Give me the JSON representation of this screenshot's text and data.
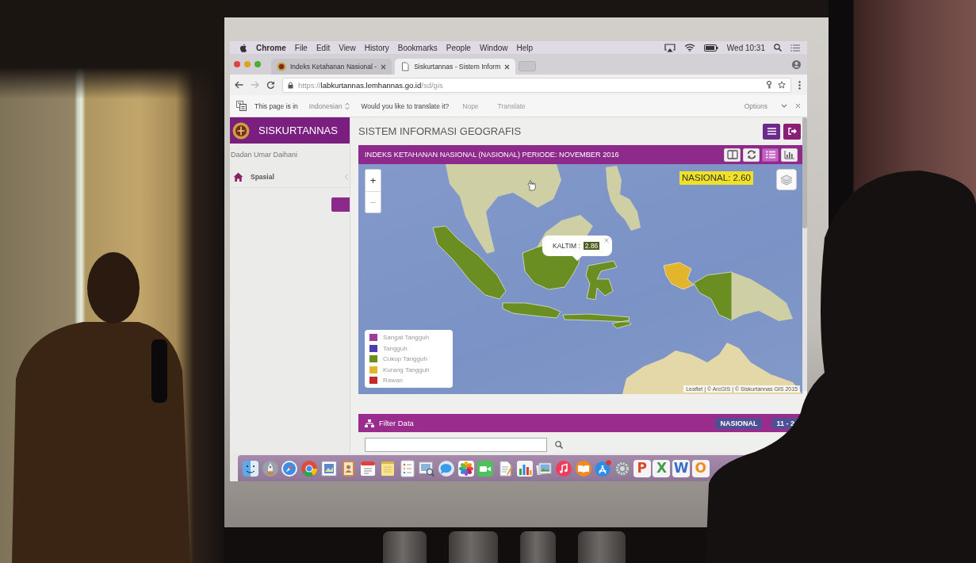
{
  "menu_bar": {
    "app": "Chrome",
    "menus": [
      "File",
      "Edit",
      "View",
      "History",
      "Bookmarks",
      "People",
      "Window",
      "Help"
    ],
    "clock": "Wed 10:31"
  },
  "tabs": [
    {
      "title": "Indeks Ketahanan Nasional -",
      "kind": "emblem",
      "selected": false
    },
    {
      "title": "Siskurtannas - Sistem Inform",
      "kind": "page",
      "selected": true
    }
  ],
  "address_bar": {
    "scheme": "https://",
    "host": "labkurtannas.lemhannas.go.id",
    "path": "/sd/gis"
  },
  "translate_bar": {
    "prompt": "This page is in",
    "language": "Indonesian",
    "question": "Would you like to translate it?",
    "actions": [
      "Nope",
      "Translate"
    ],
    "options": "Options"
  },
  "sidebar": {
    "brand": "SISKURTANNAS",
    "user": "Dadan Umar Daihani",
    "items": [
      {
        "label": "Spasial"
      }
    ]
  },
  "page_title": "SISTEM INFORMASI GEOGRAFIS",
  "map_panel": {
    "title": "INDEKS KETAHANAN NASIONAL (NASIONAL) PERIODE: NOVEMBER 2016",
    "tools": [
      {
        "kind": "columns",
        "selected": false
      },
      {
        "kind": "refresh",
        "selected": false
      },
      {
        "kind": "list",
        "selected": true
      },
      {
        "kind": "chart",
        "selected": false
      }
    ],
    "zoom": [
      {
        "label": "+",
        "disabled": false
      },
      {
        "label": "−",
        "disabled": true
      }
    ],
    "national_score": "NASIONAL: 2.60",
    "popup": {
      "region": "KALTIM :",
      "value": "2.86"
    },
    "legend": [
      {
        "label": "Sangat Tangguh",
        "color": "#9b3d99"
      },
      {
        "label": "Tangguh",
        "color": "#4b3fae"
      },
      {
        "label": "Cukup Tangguh",
        "color": "#6b8e23"
      },
      {
        "label": "Kurang Tangguh",
        "color": "#e3b52a"
      },
      {
        "label": "Rawan",
        "color": "#c32a2a"
      }
    ],
    "attribution": "Leaflet | © ArcGIS | © Siskurtannas GIS 2015"
  },
  "filter_panel": {
    "title": "Filter Data",
    "badges": [
      "NASIONAL",
      "11 - 2"
    ]
  },
  "dock": [
    {
      "kind": "finder"
    },
    {
      "kind": "launchpad"
    },
    {
      "kind": "compass"
    },
    {
      "kind": "ring"
    },
    {
      "kind": "stamp"
    },
    {
      "kind": "contacts"
    },
    {
      "kind": "calendar"
    },
    {
      "kind": "notepad"
    },
    {
      "kind": "checklist"
    },
    {
      "kind": "preview"
    },
    {
      "kind": "messages"
    },
    {
      "kind": "flower"
    },
    {
      "kind": "camera"
    },
    {
      "kind": "document"
    },
    {
      "kind": "chart"
    },
    {
      "kind": "photos"
    },
    {
      "kind": "music"
    },
    {
      "kind": "books"
    },
    {
      "kind": "store"
    },
    {
      "kind": "gear"
    },
    {
      "kind": "letter",
      "text": "P",
      "color": "#d9482b"
    },
    {
      "kind": "letter",
      "text": "X",
      "color": "#3f9e46"
    },
    {
      "kind": "letter",
      "text": "W",
      "color": "#3b6fc4"
    },
    {
      "kind": "letter",
      "text": "O",
      "color": "#f08c1e"
    }
  ]
}
